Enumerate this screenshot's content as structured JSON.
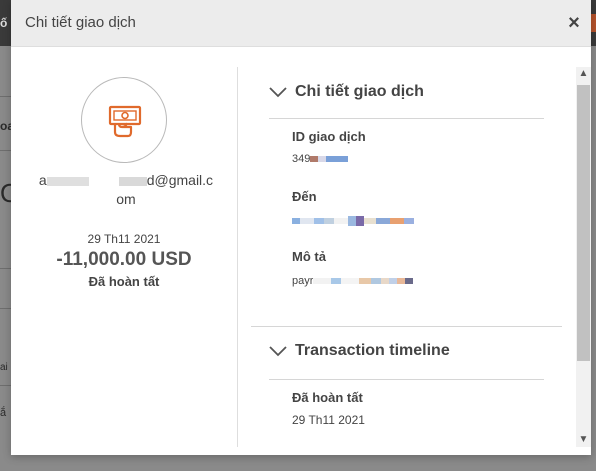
{
  "modal": {
    "title": "Chi tiết giao dịch",
    "close_label": "×"
  },
  "transaction": {
    "email_prefix": "a",
    "email_suffix": "d@gmail.c",
    "email_tail": "om",
    "date": "29 Th11 2021",
    "amount": "-11,000.00 USD",
    "status": "Đã hoàn tất",
    "icon": "cash-payment-icon",
    "accent_color": "#e06a2c"
  },
  "details": {
    "heading": "Chi tiết giao dịch",
    "fields": [
      {
        "label": "ID giao dịch",
        "value": "349"
      },
      {
        "label": "Đến",
        "value": ""
      },
      {
        "label": "Mô tả",
        "value": "payr"
      }
    ]
  },
  "timeline": {
    "heading": "Transaction timeline",
    "status": "Đã hoàn tất",
    "date": "29 Th11 2021"
  },
  "background": {
    "frag1": "ố",
    "frag2": "oa",
    "frag3": "O",
    "frag4": "ai",
    "frag5": "ắ"
  }
}
